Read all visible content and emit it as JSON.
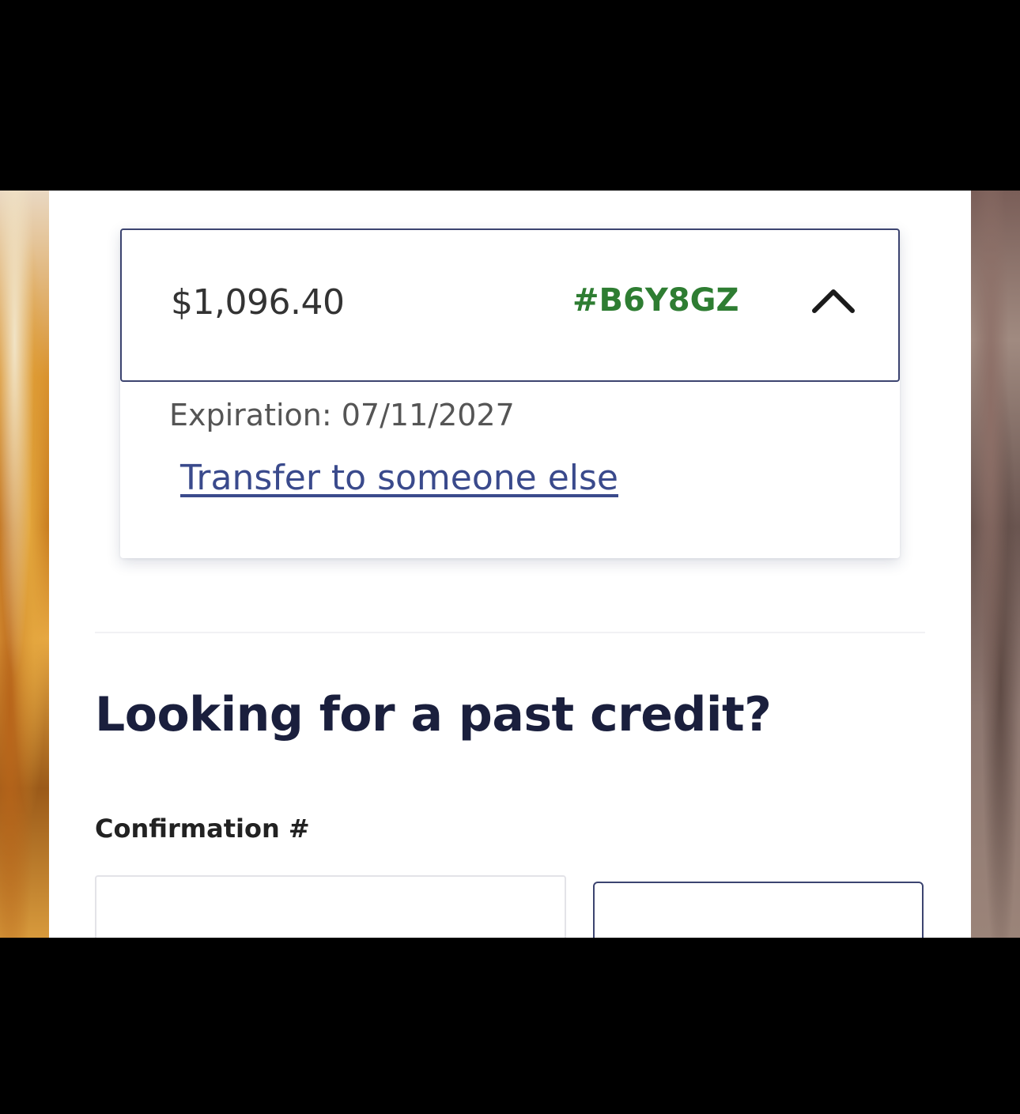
{
  "credit": {
    "amount": "$1,096.40",
    "confirmation_code": "#B6Y8GZ",
    "code_color": "#2e7d32",
    "toggle_icon": "chevron-up-icon",
    "expiration_text": "Expiration: 07/11/2027",
    "transfer_link_text": "Transfer to someone else"
  },
  "past_credit": {
    "heading": "Looking for a past credit?",
    "confirmation_label": "Confirmation #",
    "confirmation_value": ""
  },
  "colors": {
    "brand_navy": "#1a1f3d",
    "border_navy": "#3c4470",
    "link": "#3a4a8c"
  }
}
